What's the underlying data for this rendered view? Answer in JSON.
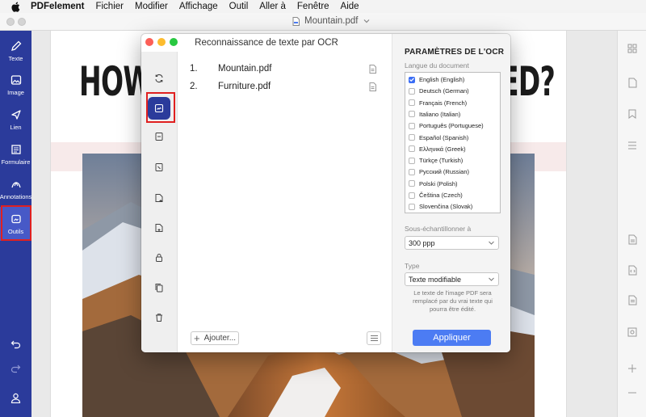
{
  "menubar": {
    "app_name": "PDFelement",
    "items": [
      "Fichier",
      "Modifier",
      "Affichage",
      "Outil",
      "Aller à",
      "Fenêtre",
      "Aide"
    ]
  },
  "window": {
    "doc_title": "Mountain.pdf"
  },
  "sidebar": {
    "items": [
      {
        "label": "Texte",
        "icon": "pencil-icon"
      },
      {
        "label": "Image",
        "icon": "image-icon"
      },
      {
        "label": "Lien",
        "icon": "link-icon"
      },
      {
        "label": "Formulaire",
        "icon": "form-icon"
      },
      {
        "label": "Annotations",
        "icon": "annotation-icon"
      },
      {
        "label": "Outils",
        "icon": "tools-icon"
      }
    ],
    "active": "Outils"
  },
  "document": {
    "headline_left": "HOW",
    "headline_right": "ED?"
  },
  "dialog": {
    "title": "Reconnaissance de texte par OCR",
    "files": [
      {
        "num": "1.",
        "name": "Mountain.pdf"
      },
      {
        "num": "2.",
        "name": "Furniture.pdf"
      }
    ],
    "add_label": "Ajouter...",
    "settings": {
      "heading": "PARAMÈTRES DE L'OCR",
      "language_label": "Langue du document",
      "languages": [
        {
          "name": "English (English)",
          "checked": true
        },
        {
          "name": "Deutsch (German)",
          "checked": false
        },
        {
          "name": "Français (French)",
          "checked": false
        },
        {
          "name": "Italiano (Italian)",
          "checked": false
        },
        {
          "name": "Português (Portuguese)",
          "checked": false
        },
        {
          "name": "Español (Spanish)",
          "checked": false
        },
        {
          "name": "Ελληνικά (Greek)",
          "checked": false
        },
        {
          "name": "Türkçe (Turkish)",
          "checked": false
        },
        {
          "name": "Русский (Russian)",
          "checked": false
        },
        {
          "name": "Polski (Polish)",
          "checked": false
        },
        {
          "name": "Čeština (Czech)",
          "checked": false
        },
        {
          "name": "Slovenčina (Slovak)",
          "checked": false
        }
      ],
      "downsample_label": "Sous-échantillonner à",
      "downsample_value": "300 ppp",
      "type_label": "Type",
      "type_value": "Texte modifiable",
      "hint": "Le texte de l'image PDF sera remplacé par du vrai texte qui pourra être édité.",
      "apply_label": "Appliquer"
    }
  },
  "colors": {
    "sidebar": "#2b3b9b",
    "accent": "#4c7cf3",
    "highlight": "#e02020"
  }
}
